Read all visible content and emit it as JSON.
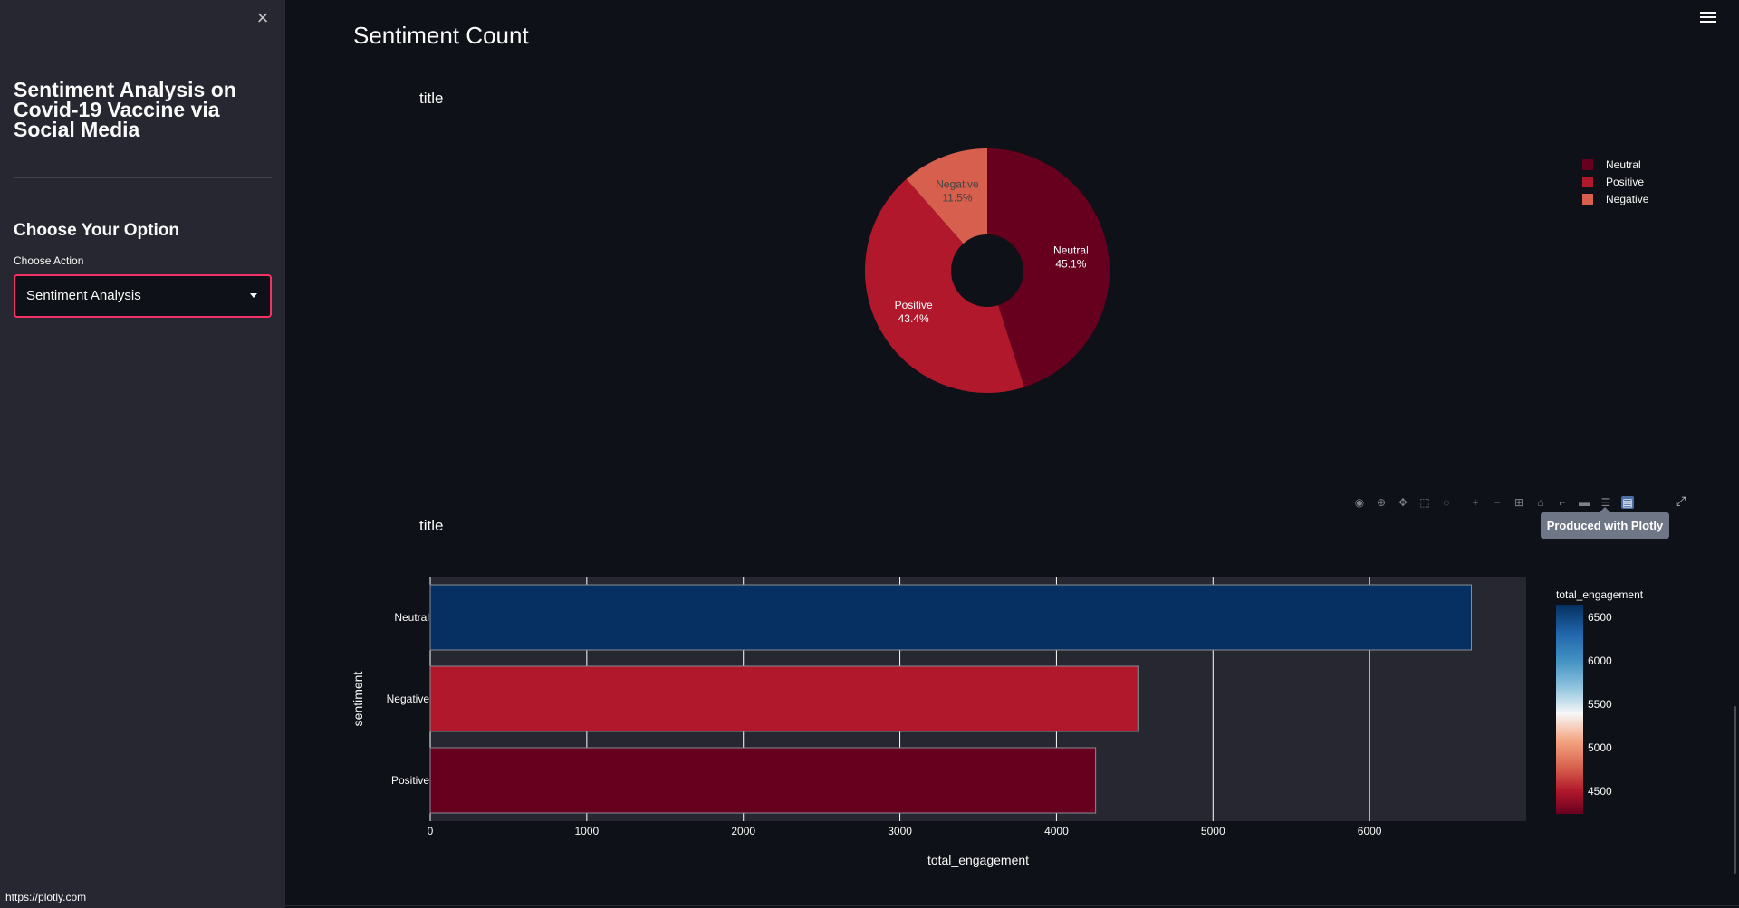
{
  "sidebar": {
    "close_glyph": "×",
    "app_title": "Sentiment Analysis on Covid-19 Vaccine via Social Media",
    "option_heading": "Choose Your Option",
    "action_label": "Choose Action",
    "action_value": "Sentiment Analysis"
  },
  "main": {
    "page_title": "Sentiment Count"
  },
  "modebar": {
    "tooltip": "Produced with Plotly",
    "icons": [
      "camera-icon",
      "zoom-icon",
      "pan-icon",
      "box-select-icon",
      "lasso-icon",
      "zoom-in-icon",
      "zoom-out-icon",
      "autoscale-icon",
      "reset-axes-icon",
      "spike-lines-icon",
      "hover-closest-icon",
      "hover-compare-icon",
      "plotly-logo-icon"
    ]
  },
  "status_bar": {
    "url": "https://plotly.com"
  },
  "colors": {
    "accent": "#f63366",
    "neutral": "#67001f",
    "positive": "#b2182b",
    "negative": "#d6604d",
    "bar_neutral": "#053061",
    "plot_bg": "#262730"
  },
  "chart_data": [
    {
      "type": "pie",
      "title": "title",
      "hole": true,
      "labels": [
        "Neutral",
        "Positive",
        "Negative"
      ],
      "values": [
        45.1,
        43.4,
        11.5
      ],
      "slice_labels": [
        [
          "Neutral",
          "45.1%"
        ],
        [
          "Positive",
          "43.4%"
        ],
        [
          "Negative",
          "11.5%"
        ]
      ],
      "colors": [
        "#67001f",
        "#b2182b",
        "#d6604d"
      ],
      "legend_position": "top-right"
    },
    {
      "type": "bar",
      "orientation": "horizontal",
      "title": "title",
      "categories": [
        "Neutral",
        "Negative",
        "Positive"
      ],
      "values": [
        6650,
        4520,
        4250
      ],
      "colors": [
        "#053061",
        "#b2182b",
        "#67001f"
      ],
      "xlabel": "total_engagement",
      "ylabel": "sentiment",
      "xlim": [
        0,
        7000
      ],
      "x_ticks": [
        "0",
        "1000",
        "2000",
        "3000",
        "4000",
        "5000",
        "6000"
      ],
      "grid": true,
      "colorbar": {
        "title": "total_engagement",
        "ticks": [
          "6500",
          "6000",
          "5500",
          "5000",
          "4500"
        ],
        "range": [
          4250,
          6650
        ]
      }
    }
  ]
}
